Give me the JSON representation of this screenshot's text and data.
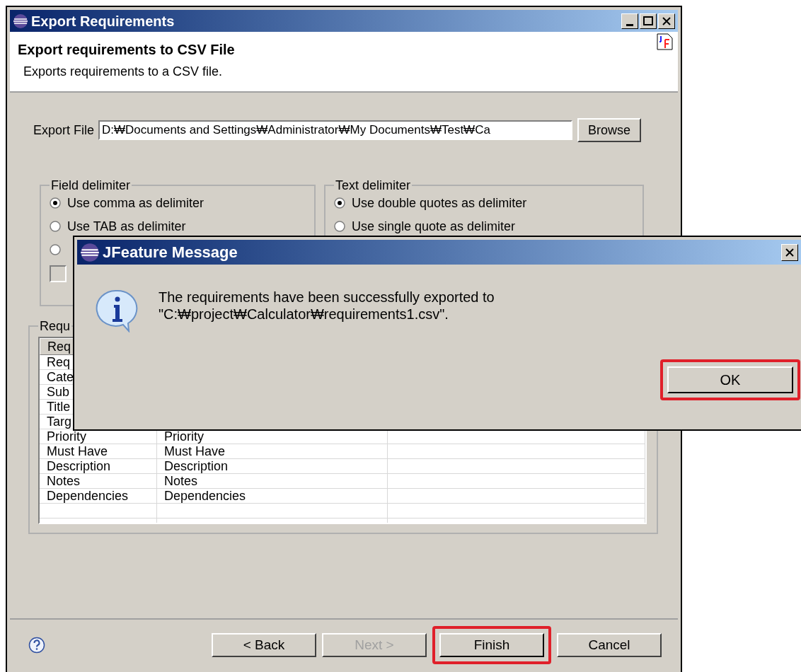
{
  "main_window": {
    "title": "Export Requirements"
  },
  "header": {
    "title": "Export requirements to CSV File",
    "subtitle": "Exports requirements to a CSV file."
  },
  "export_file": {
    "label": "Export File",
    "value": "D:₩Documents and Settings₩Administrator₩My Documents₩Test₩Ca",
    "button": "Browse"
  },
  "field_delimiter": {
    "title": "Field delimiter",
    "options": [
      {
        "label": "Use comma as delimiter",
        "selected": true
      },
      {
        "label": "Use TAB as delimiter",
        "selected": false
      },
      {
        "selected": false
      }
    ],
    "checkbox": {
      "checked": false
    }
  },
  "text_delimiter": {
    "title": "Text delimiter",
    "options": [
      {
        "label": "Use double quotes as delimiter",
        "selected": true
      },
      {
        "label": "Use single quote as delimiter",
        "selected": false
      }
    ]
  },
  "requirements": {
    "title": "Requ",
    "columns": [
      "Req"
    ],
    "rows": [
      {
        "cells": [
          "Req"
        ]
      },
      {
        "cells": [
          "Cate"
        ]
      },
      {
        "cells": [
          "Sub"
        ]
      },
      {
        "cells": [
          "Title"
        ]
      },
      {
        "cells": [
          "Targ"
        ]
      },
      {
        "cells": [
          "Priority",
          "Priority"
        ]
      },
      {
        "cells": [
          "Must Have",
          "Must Have"
        ]
      },
      {
        "cells": [
          "Description",
          "Description"
        ]
      },
      {
        "cells": [
          "Notes",
          "Notes"
        ]
      },
      {
        "cells": [
          "Dependencies",
          "Dependencies"
        ]
      }
    ]
  },
  "buttons": [
    {
      "label": "< Back",
      "disabled": false,
      "highlighted": false
    },
    {
      "label": "Next >",
      "disabled": true,
      "highlighted": false
    },
    {
      "label": "Finish",
      "disabled": false,
      "highlighted": true
    },
    {
      "label": "Cancel",
      "disabled": false,
      "highlighted": false
    }
  ],
  "dialog": {
    "title": "JFeature Message",
    "message_lines": [
      "The requirements have been successfully exported to",
      "\"C:₩project₩Calculator₩requirements1.csv\"."
    ],
    "button": {
      "label": "OK",
      "highlighted": true
    }
  }
}
